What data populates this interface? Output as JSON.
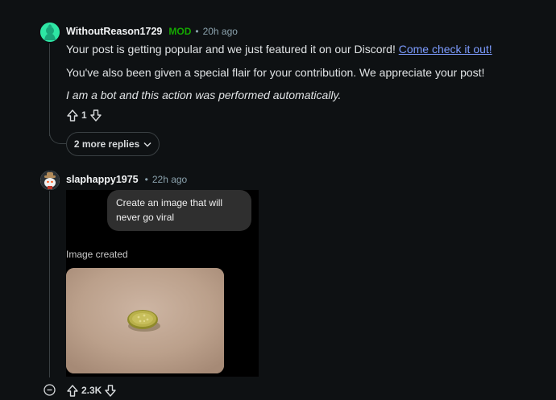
{
  "comments": [
    {
      "author": "WithoutReason1729",
      "badge": "MOD",
      "separator": "•",
      "time": "20h ago",
      "paragraph1": "Your post is getting popular and we just featured it on our Discord! ",
      "link_text": "Come check it out!",
      "paragraph2": "You've also been given a special flair for your contribution. We appreciate your post!",
      "paragraph3": "I am a bot and this action was performed automatically.",
      "score": "1",
      "more_replies": "2 more replies"
    },
    {
      "author": "slaphappy1975",
      "separator": "•",
      "time": "22h ago",
      "image": {
        "prompt": "Create an image that will never go viral",
        "caption": "Image created",
        "subject": "pickle-slice-on-beige-surface"
      },
      "score": "2.3K"
    }
  ],
  "icons": {
    "upvote": "arrow-up-outline-icon",
    "downvote": "arrow-down-outline-icon",
    "chevron": "chevron-down-icon",
    "collapse": "minus-circle-icon"
  },
  "colors": {
    "background": "#0e1113",
    "mod_badge": "#14a800",
    "link": "#7d9cff",
    "avatar1": "#2ee6a4"
  }
}
